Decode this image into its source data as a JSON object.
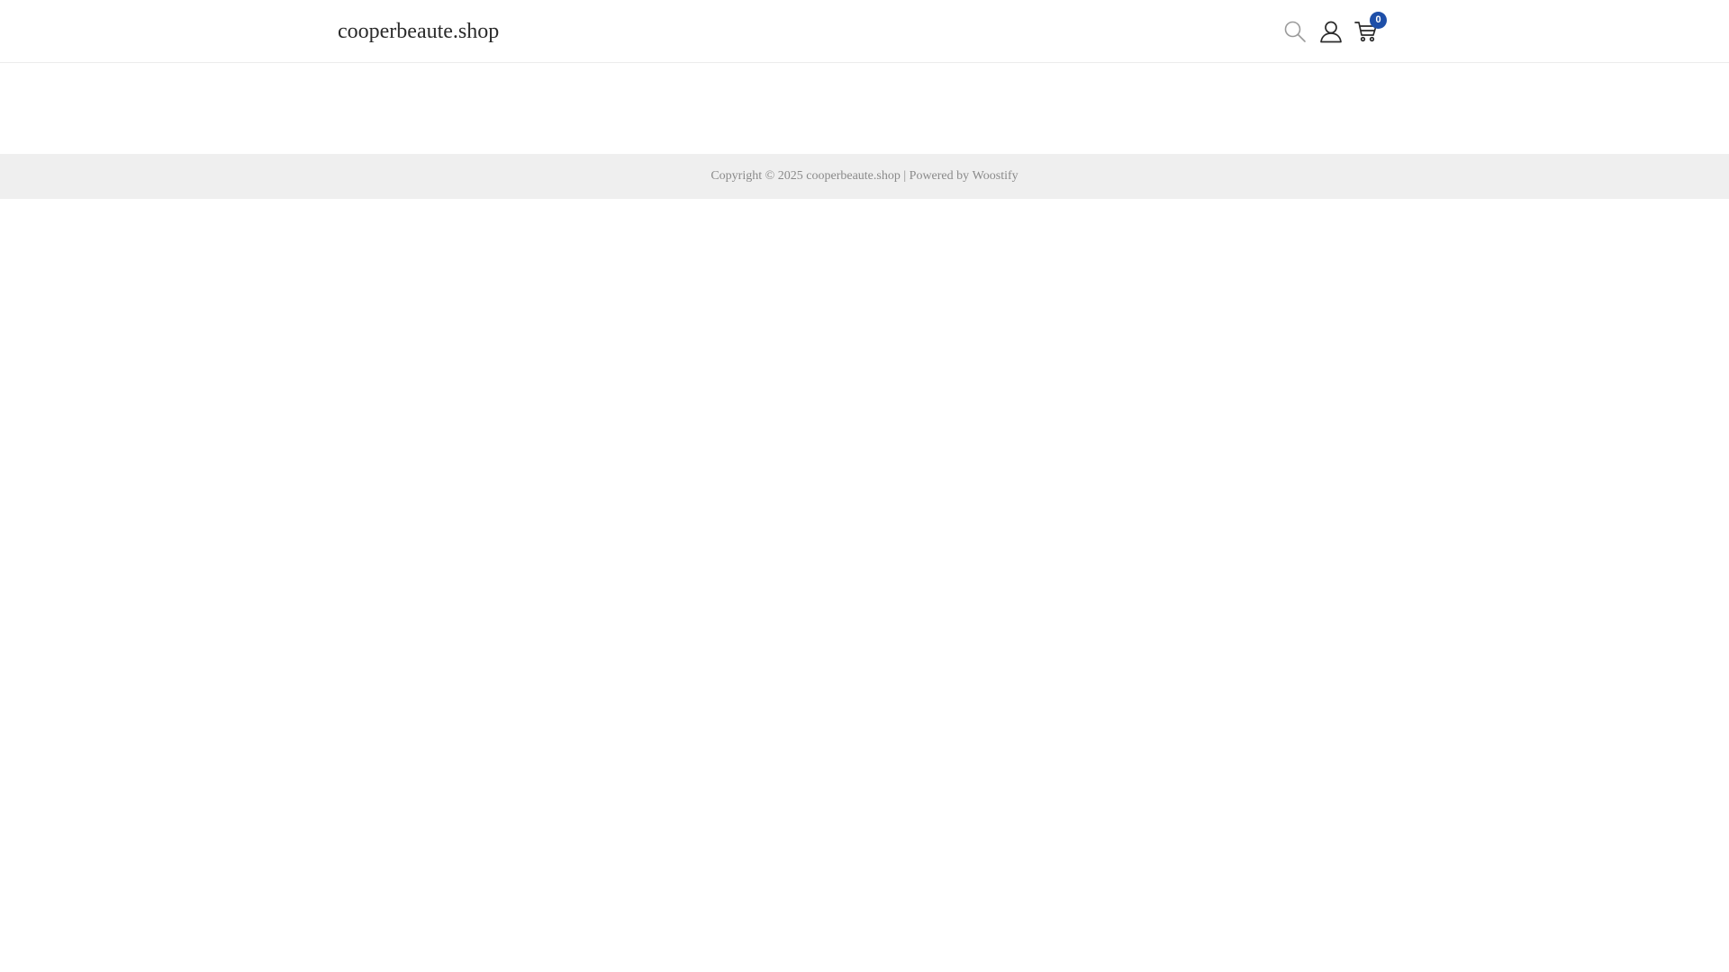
{
  "header": {
    "site_title": "cooperbeaute.shop",
    "icons": {
      "search": "search-icon",
      "account": "user-icon",
      "cart": "cart-icon"
    },
    "cart_count": "0",
    "cart_badge_color": "#1e4fa8"
  },
  "footer": {
    "copyright_prefix": "Copyright © 2025",
    "site_link": "cooperbeaute.shop",
    "separator": "|",
    "powered_by_prefix": "Powered by",
    "powered_by_link": "Woostify",
    "background": "#efefef"
  }
}
